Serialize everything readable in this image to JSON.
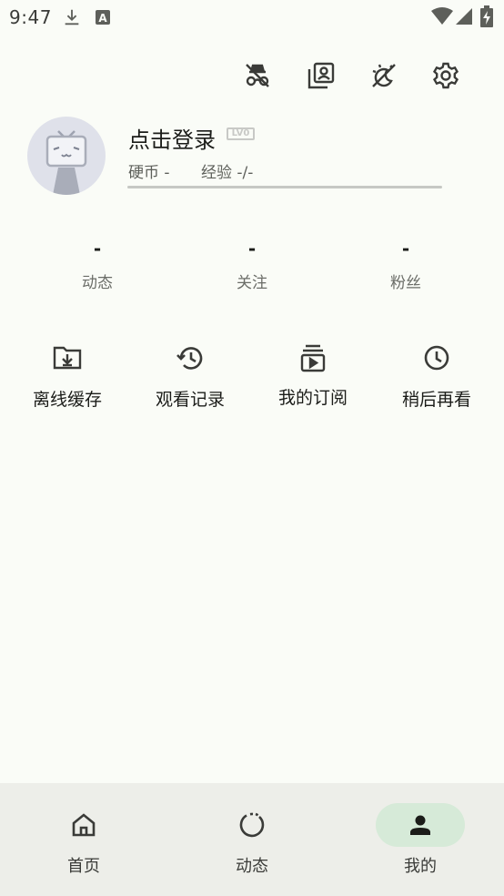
{
  "status_bar": {
    "time": "9:47",
    "icons": [
      "download-icon",
      "keyboard-a-icon",
      "wifi-icon",
      "signal-icon",
      "battery-charging-icon"
    ]
  },
  "toolbar": {
    "icons": [
      "incognito-icon",
      "switch-account-icon",
      "night-mode-icon",
      "settings-icon"
    ]
  },
  "profile": {
    "login_label": "点击登录",
    "level_badge": "LV0",
    "coins": "硬币 -",
    "exp": "经验 -/-"
  },
  "stats": [
    {
      "value": "-",
      "label": "动态"
    },
    {
      "value": "-",
      "label": "关注"
    },
    {
      "value": "-",
      "label": "粉丝"
    }
  ],
  "quick_actions": [
    {
      "label": "离线缓存",
      "icon": "folder-download-icon"
    },
    {
      "label": "观看记录",
      "icon": "history-icon"
    },
    {
      "label": "我的订阅",
      "icon": "subscriptions-icon"
    },
    {
      "label": "稍后再看",
      "icon": "clock-icon"
    }
  ],
  "bottom_nav": [
    {
      "label": "首页",
      "icon": "home-icon",
      "active": false
    },
    {
      "label": "动态",
      "icon": "dynamic-icon",
      "active": false
    },
    {
      "label": "我的",
      "icon": "person-icon",
      "active": true
    }
  ],
  "colors": {
    "background": "#fafcf7",
    "nav_background": "#edeee9",
    "active_pill": "#d6ead8",
    "icon": "#3a3b38"
  }
}
